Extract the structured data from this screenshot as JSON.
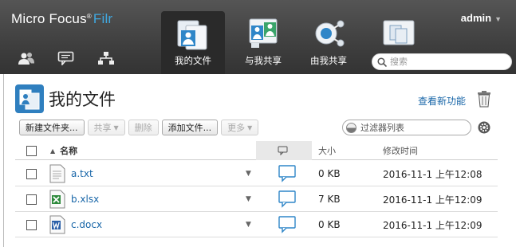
{
  "header": {
    "brand_main": "Micro Focus",
    "brand_reg": "®",
    "brand_product": "Filr",
    "user": "admin",
    "search_placeholder": "搜索",
    "tabs": [
      {
        "label": "我的文件",
        "icon": "my-files-icon",
        "active": true
      },
      {
        "label": "与我共享",
        "icon": "shared-with-me-icon",
        "active": false
      },
      {
        "label": "由我共享",
        "icon": "shared-by-me-icon",
        "active": false
      },
      {
        "label": "",
        "icon": "net-folders-icon",
        "active": false
      }
    ],
    "quick_icons": [
      "people-icon",
      "comments-icon",
      "org-chart-icon"
    ]
  },
  "page": {
    "title": "我的文件",
    "whats_new": "查看新功能"
  },
  "toolbar": {
    "new_folder": "新建文件夹...",
    "share": "共享",
    "delete": "删除",
    "add_files": "添加文件...",
    "more": "更多",
    "filter_placeholder": "过滤器列表"
  },
  "table": {
    "col_name": "名称",
    "col_size": "大小",
    "col_modified": "修改时间",
    "rows": [
      {
        "name": "a.txt",
        "type": "txt",
        "size": "0 KB",
        "modified": "2016-11-1 上午12:08"
      },
      {
        "name": "b.xlsx",
        "type": "xlsx",
        "size": "7 KB",
        "modified": "2016-11-1 上午12:09"
      },
      {
        "name": "c.docx",
        "type": "docx",
        "size": "0 KB",
        "modified": "2016-11-1 上午12:09"
      }
    ]
  },
  "colors": {
    "accent": "#1866a8",
    "brand_blue": "#40a8e0",
    "topbar": "#444444"
  }
}
